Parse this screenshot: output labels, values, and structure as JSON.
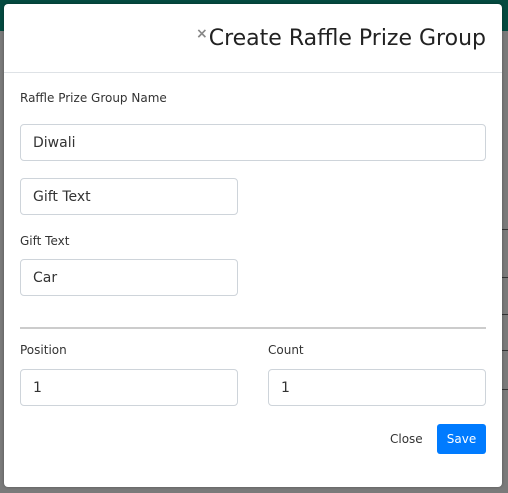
{
  "modal": {
    "title": "Create Raffle Prize Group",
    "close_icon": "×",
    "group_name_label": "Raffle Prize Group Name",
    "group_name_value": "Diwali",
    "gift_text_field_value": "Gift Text",
    "gift_text_label": "Gift Text",
    "gift_text_value": "Car",
    "position_label": "Position",
    "position_value": "1",
    "count_label": "Count",
    "count_value": "1",
    "close_label": "Close",
    "save_label": "Save"
  },
  "colors": {
    "primary": "#007bff",
    "topbar": "#044a40"
  }
}
